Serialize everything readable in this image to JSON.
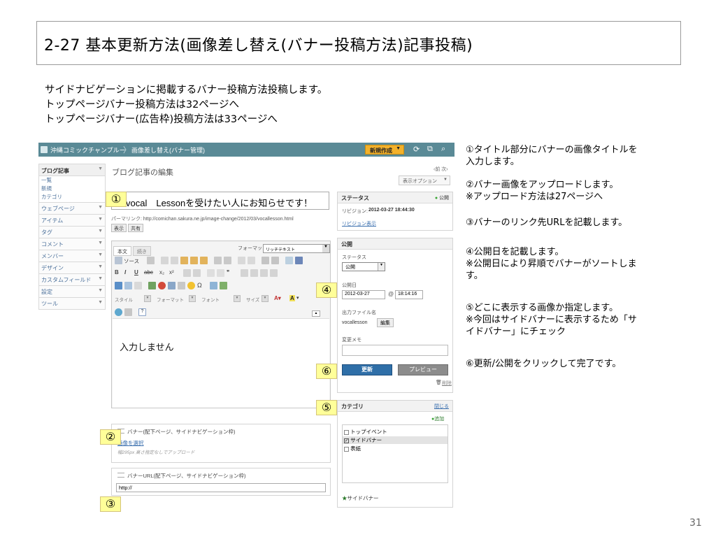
{
  "slide": {
    "title": "2-27 基本更新方法(画像差し替え(バナー投稿方法)記事投稿)",
    "intro_lines": [
      "サイドナビゲーションに掲載するバナー投稿方法投稿します。",
      "トップページバナー投稿方法は32ページへ",
      "トップページバナー(広告枠)投稿方法は33ページへ"
    ],
    "page_number": "31"
  },
  "topbar": {
    "site_name": "沖縄コミックチャンプルー",
    "breadcrumb": "画像差し替え(バナー管理)",
    "new_button": "新規作成"
  },
  "sidebar": {
    "items": [
      {
        "label": "ブログ記事",
        "subs": [
          "一覧",
          "新規",
          "カテゴリ"
        ]
      },
      {
        "label": "ウェブページ"
      },
      {
        "label": "アイテム"
      },
      {
        "label": "タグ"
      },
      {
        "label": "コメント"
      },
      {
        "label": "メンバー"
      },
      {
        "label": "デザイン"
      },
      {
        "label": "カスタムフィールド"
      },
      {
        "label": "設定"
      },
      {
        "label": "ツール"
      }
    ]
  },
  "editor_page": {
    "heading": "ブログ記事の編集",
    "prev": "‹前",
    "next": "次›",
    "display_options": "表示オプション",
    "title_value": "vocal　Lessonを受けたい人にお知らせです！",
    "permalink_label": "パーマリンク:",
    "permalink_url": "http://comichan.sakura.ne.jp/image-change/2012/03/vocallesson.html",
    "view_button": "表示",
    "share_button": "共有",
    "tab_body": "本文",
    "tab_more": "続き",
    "format_label": "フォーマット:",
    "format_value": "リッチテキスト",
    "toolbar_row1_source": "ソース",
    "toolbar_style": "スタイル",
    "toolbar_format": "フォーマット",
    "toolbar_font": "フォント",
    "toolbar_size": "サイズ",
    "body_text": "入力しません"
  },
  "status_box": {
    "title": "ステータス",
    "state": "公開",
    "revision_label": "リビジョン:",
    "revision_value": "2012-03-27 18:44:30",
    "revision_link": "リビジョン表示"
  },
  "publish_box": {
    "title": "公開",
    "status_label": "ステータス",
    "status_value": "公開",
    "date_label": "公開日",
    "date_value": "2012-03-27",
    "time_value": "18:14:16",
    "filename_label": "出力ファイル名",
    "filename_value": "vocallesson",
    "edit_button": "編集",
    "memo_label": "変更メモ",
    "update_button": "更新",
    "preview_button": "プレビュー",
    "delete_link": "削除"
  },
  "category_box": {
    "title": "カテゴリ",
    "close_link": "閉じる",
    "add_link": "追加",
    "items": [
      {
        "label": "トップイベント",
        "checked": false
      },
      {
        "label": "サイドバナー",
        "checked": true
      },
      {
        "label": "表紙",
        "checked": false
      }
    ],
    "selected_label": "サイドバナー"
  },
  "banner_field": {
    "title": "バナー(配下ページ、サイドナビゲーション枠)",
    "select_link": "画像を選択",
    "hint": "幅295px  高さ指定なしでアップロード"
  },
  "banner_url_field": {
    "title": "バナーURL(配下ページ、サイドナビゲーション枠)",
    "value": "http://"
  },
  "badges": [
    "①",
    "②",
    "③",
    "④",
    "⑤",
    "⑥"
  ],
  "notes": [
    "①タイトル部分にバナーの画像タイトルを入力します。",
    "②バナー画像をアップロードします。※アップロード方法は27ページへ",
    "③バナーのリンク先URLを記載します。",
    "④公開日を記載します。※公開日により昇順でバナーがソートしま す。",
    "⑤どこに表示する画像か指定します。※今回はサイドバナーに表示するため「サイドバナー」にチェック",
    "⑥更新/公開をクリックして完了です。"
  ],
  "notes_lines": [
    [
      "①タイトル部分にバナーの画像タイトルを",
      "入力します。"
    ],
    [
      "②バナー画像をアップロードします。",
      "※アップロード方法は27ページへ"
    ],
    [
      "③バナーのリンク先URLを記載します。"
    ],
    [
      "④公開日を記載します。",
      "※公開日により昇順でバナーがソートしま",
      "す。"
    ],
    [
      "⑤どこに表示する画像か指定します。",
      "※今回はサイドバナーに表示するため「サ",
      "イドバナー」にチェック"
    ],
    [
      "⑥更新/公開をクリックして完了です。"
    ]
  ],
  "colors": {
    "topbar": "#5a8a96",
    "accent_orange": "#f3b12b",
    "badge_yellow": "#ffff99",
    "update_blue": "#2f6fa8",
    "link_blue": "#3a6fae",
    "status_green": "#3aa635"
  }
}
